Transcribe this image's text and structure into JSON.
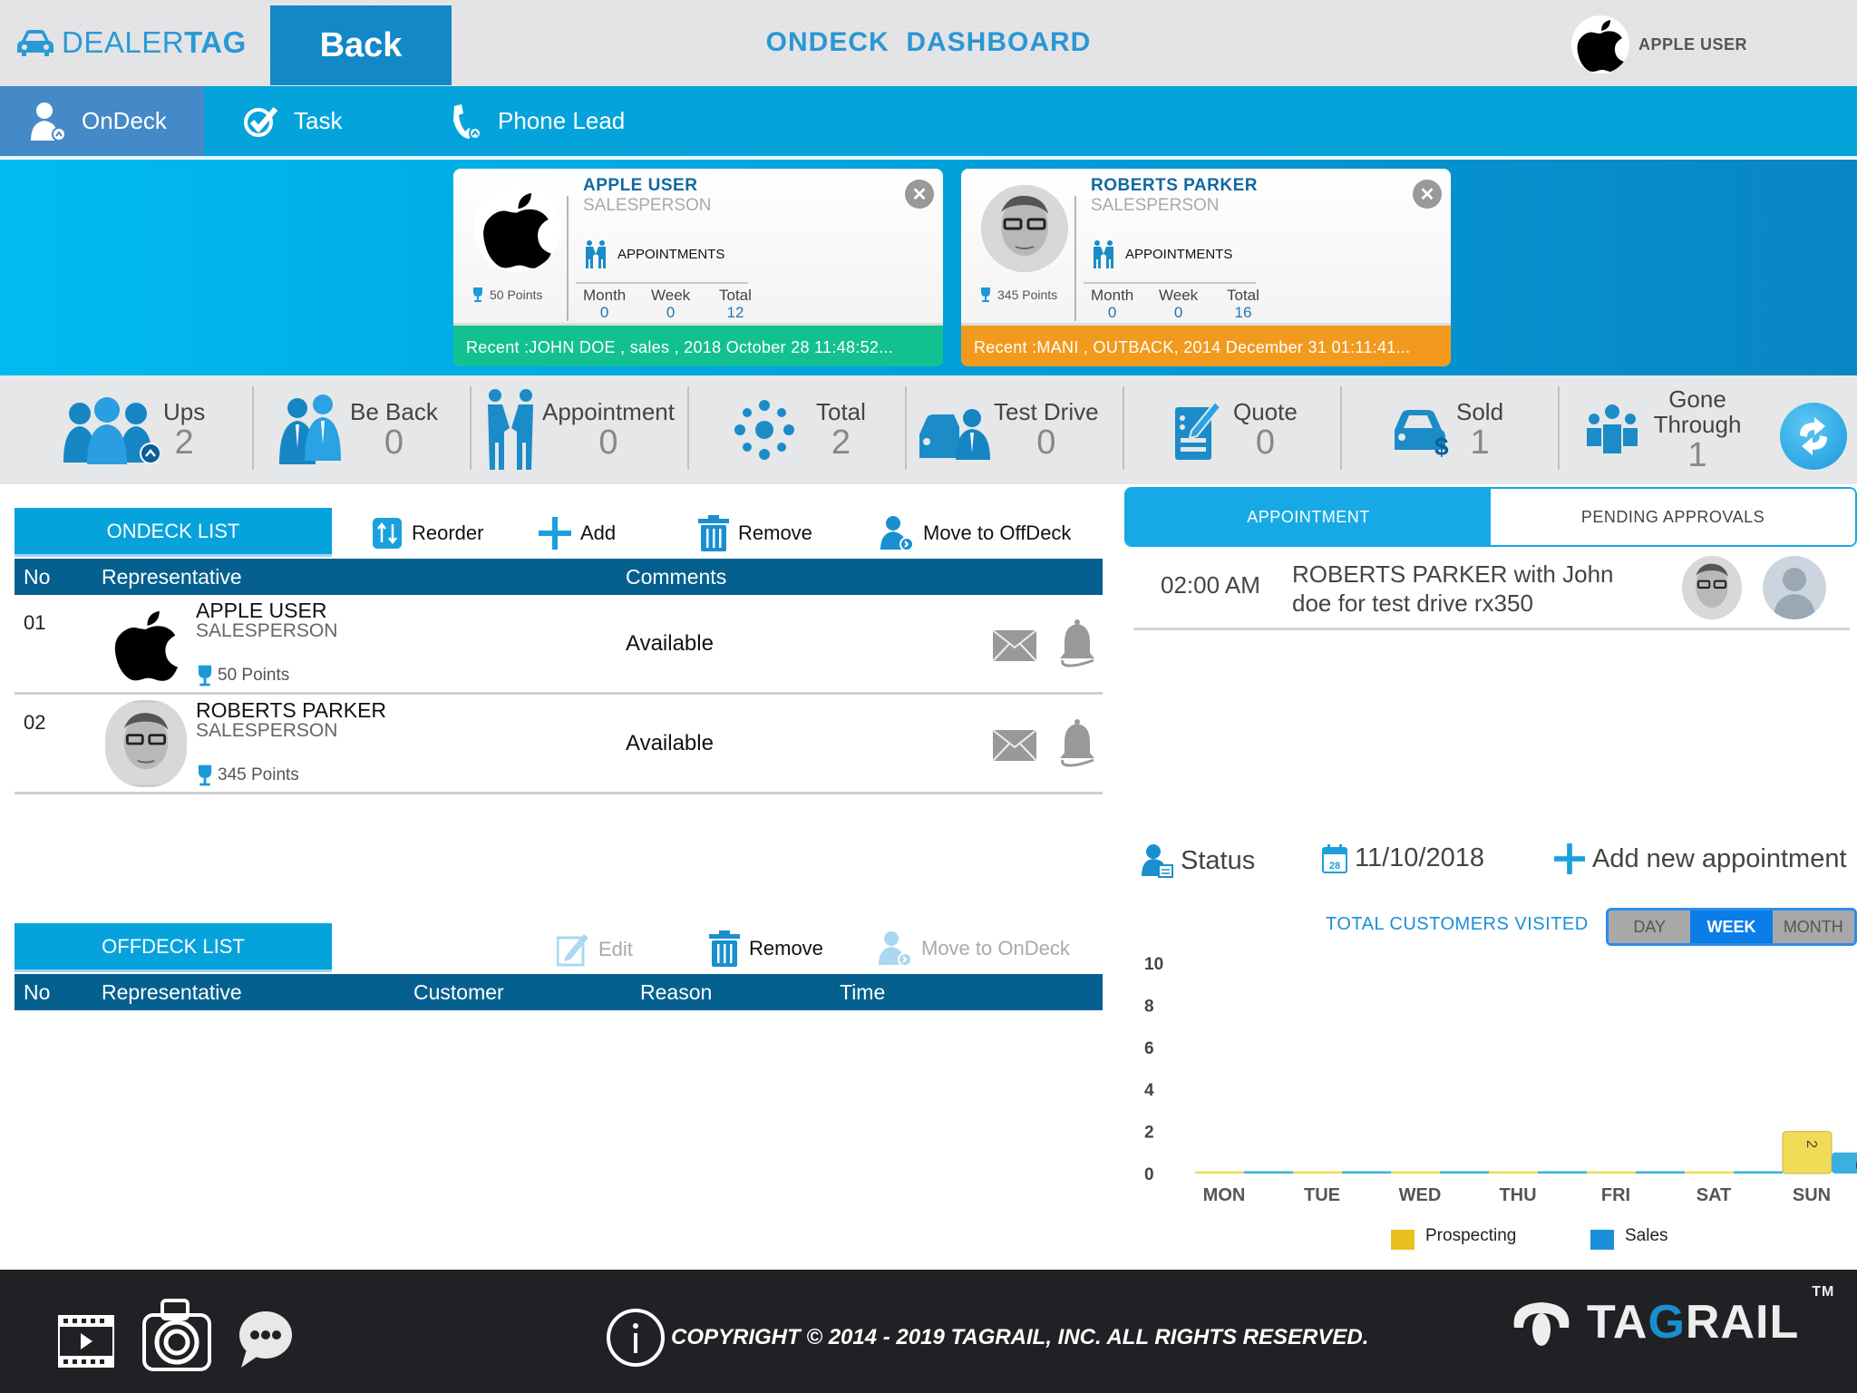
{
  "header": {
    "logo_light": "DEALER",
    "logo_bold": "TAG",
    "back_label": "Back",
    "title": "ONDECK  DASHBOARD",
    "user_name": "APPLE USER"
  },
  "nav": {
    "tabs": [
      {
        "label": "OnDeck",
        "icon": "user-up-icon",
        "active": true
      },
      {
        "label": "Task",
        "icon": "check-circle-icon",
        "active": false
      },
      {
        "label": "Phone Lead",
        "icon": "phone-icon",
        "active": false
      }
    ]
  },
  "cards": [
    {
      "name": "APPLE USER",
      "role": "SALESPERSON",
      "points": "50 Points",
      "section_label": "APPOINTMENTS",
      "month_label": "Month",
      "month": "0",
      "week_label": "Week",
      "week": "0",
      "total_label": "Total",
      "total": "12",
      "recent": "Recent :JOHN DOE  , sales , 2018 October 28 11:48:52...",
      "recent_color": "#12c18f"
    },
    {
      "name": "ROBERTS PARKER",
      "role": "SALESPERSON",
      "points": "345 Points",
      "section_label": "APPOINTMENTS",
      "month_label": "Month",
      "month": "0",
      "week_label": "Week",
      "week": "0",
      "total_label": "Total",
      "total": "16",
      "recent": "Recent :MANI  ,  OUTBACK, 2014 December 31 01:11:41...",
      "recent_color": "#f29a1e"
    }
  ],
  "stats": [
    {
      "label": "Ups",
      "value": "2",
      "icon": "group-icon"
    },
    {
      "label": "Be Back",
      "value": "0",
      "icon": "businessmen-icon"
    },
    {
      "label": "Appointment",
      "value": "0",
      "icon": "handshake-icon"
    },
    {
      "label": "Total",
      "value": "2",
      "icon": "dots-circle-icon"
    },
    {
      "label": "Test Drive",
      "value": "0",
      "icon": "car-person-icon"
    },
    {
      "label": "Quote",
      "value": "0",
      "icon": "quote-form-icon"
    },
    {
      "label": "Sold",
      "value": "1",
      "icon": "car-dollar-icon"
    },
    {
      "label": "Gone Through",
      "value": "1",
      "icon": "people-icon"
    }
  ],
  "ondeck": {
    "tab_label": "ONDECK LIST",
    "tools": {
      "reorder": "Reorder",
      "add": "Add",
      "remove": "Remove",
      "move": "Move to OffDeck"
    },
    "columns": {
      "no": "No",
      "rep": "Representative",
      "comments": "Comments"
    },
    "rows": [
      {
        "no": "01",
        "name": "APPLE USER",
        "role": "SALESPERSON",
        "points": "50 Points",
        "comment": "Available"
      },
      {
        "no": "02",
        "name": "ROBERTS PARKER",
        "role": "SALESPERSON",
        "points": "345 Points",
        "comment": "Available"
      }
    ]
  },
  "offdeck": {
    "tab_label": "OFFDECK LIST",
    "tools": {
      "edit": "Edit",
      "remove": "Remove",
      "move": "Move to OnDeck"
    },
    "columns": {
      "no": "No",
      "rep": "Representative",
      "customer": "Customer",
      "reason": "Reason",
      "time": "Time"
    }
  },
  "right": {
    "tabs": {
      "appointment": "APPOINTMENT",
      "pending": "PENDING APPROVALS"
    },
    "appointment": {
      "time": "02:00 AM",
      "text": "ROBERTS PARKER with John doe for test drive rx350"
    },
    "status_label": "Status",
    "date": "11/10/2018",
    "add_label": "Add new appointment",
    "tcv_label": "TOTAL CUSTOMERS VISITED",
    "range": {
      "day": "DAY",
      "week": "WEEK",
      "month": "MONTH",
      "selected": "WEEK"
    }
  },
  "chart_data": {
    "type": "bar",
    "title": "TOTAL CUSTOMERS VISITED",
    "categories": [
      "MON",
      "TUE",
      "WED",
      "THU",
      "FRI",
      "SAT",
      "SUN"
    ],
    "series": [
      {
        "name": "Prospecting",
        "color": "#e8c020",
        "values": [
          0,
          0,
          0,
          0,
          0,
          0,
          2
        ]
      },
      {
        "name": "Sales",
        "color": "#1a8fd8",
        "values": [
          0,
          0,
          0,
          0,
          0,
          0,
          1
        ]
      }
    ],
    "yticks": [
      "0",
      "2",
      "4",
      "6",
      "8",
      "10"
    ],
    "ylim": [
      0,
      10
    ],
    "xlabel": "",
    "ylabel": "",
    "grid": false,
    "legend": "bottom"
  },
  "footer": {
    "copyright": "COPYRIGHT © 2014 - 2019 TAGRAIL, INC. ALL RIGHTS RESERVED.",
    "brand_a": "TA",
    "brand_g": "G",
    "brand_b": "RAIL",
    "tm": "TM"
  }
}
